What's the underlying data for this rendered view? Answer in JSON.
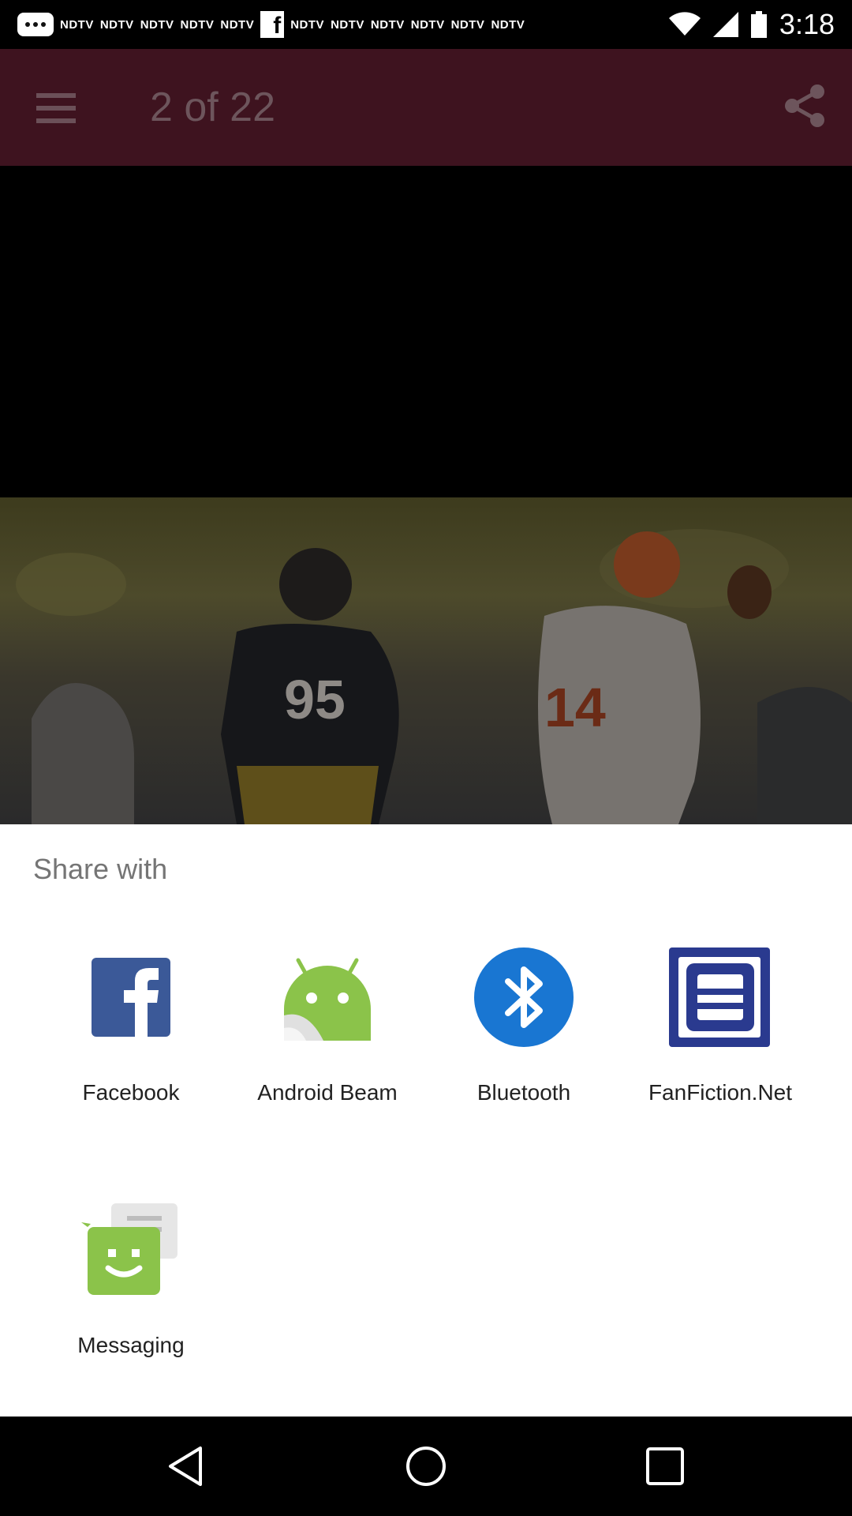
{
  "status_bar": {
    "notifications": [
      "NDTV",
      "NDTV",
      "NDTV",
      "NDTV",
      "NDTV",
      "NDTV",
      "NDTV",
      "NDTV",
      "NDTV",
      "NDTV",
      "NDTV"
    ],
    "time": "3:18"
  },
  "app_bar": {
    "page_counter": "2 of 22"
  },
  "share_sheet": {
    "title": "Share with",
    "apps": [
      {
        "label": "Facebook",
        "icon": "facebook-icon"
      },
      {
        "label": "Android Beam",
        "icon": "android-beam-icon"
      },
      {
        "label": "Bluetooth",
        "icon": "bluetooth-icon"
      },
      {
        "label": "FanFiction.Net",
        "icon": "fanfiction-icon"
      },
      {
        "label": "Messaging",
        "icon": "messaging-icon"
      }
    ]
  },
  "colors": {
    "app_bar": "#3e131f",
    "facebook": "#3b5998",
    "android": "#8bc34a",
    "bluetooth": "#1976d2",
    "fanfiction": "#2a3a8f"
  }
}
